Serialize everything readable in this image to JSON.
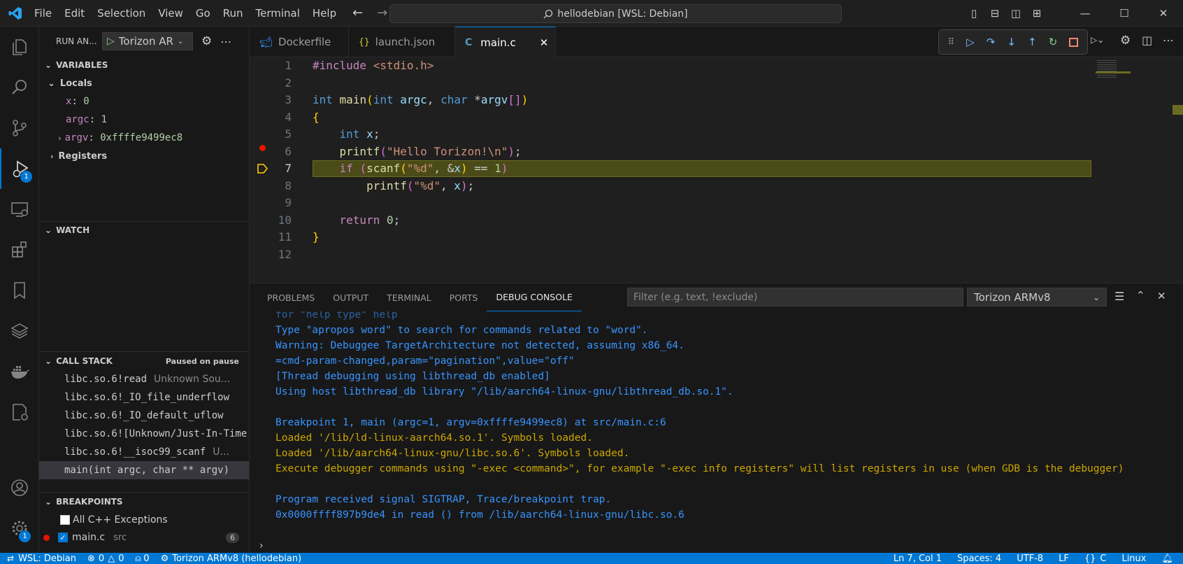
{
  "title": {
    "menus": [
      "File",
      "Edit",
      "Selection",
      "View",
      "Go",
      "Run",
      "Terminal",
      "Help"
    ],
    "command_center": "hellodebian [WSL: Debian]"
  },
  "activity": {
    "debug_badge": "1",
    "settings_badge": "1"
  },
  "sidebar": {
    "run_label": "RUN AN...",
    "config": "Torizon AR",
    "variables": {
      "header": "VARIABLES",
      "locals": "Locals",
      "items": [
        {
          "name": "x",
          "value": "0"
        },
        {
          "name": "argc",
          "value": "1"
        },
        {
          "name": "argv",
          "value": "0xffffe9499ec8"
        }
      ],
      "registers": "Registers"
    },
    "watch": {
      "header": "WATCH"
    },
    "callstack": {
      "header": "CALL STACK",
      "status": "Paused on pause",
      "frames": [
        {
          "name": "libc.so.6!read",
          "src": "Unknown Sou..."
        },
        {
          "name": "libc.so.6!_IO_file_underflow",
          "src": ""
        },
        {
          "name": "libc.so.6!_IO_default_uflow",
          "src": ""
        },
        {
          "name": "libc.so.6![Unknown/Just-In-Time",
          "src": ""
        },
        {
          "name": "libc.so.6!__isoc99_scanf",
          "src": "U..."
        },
        {
          "name": "main(int argc, char ** argv)",
          "src": ""
        }
      ]
    },
    "breakpoints": {
      "header": "BREAKPOINTS",
      "items": [
        {
          "label": "All C++ Exceptions",
          "sub": "",
          "count": ""
        },
        {
          "label": "main.c",
          "sub": "src",
          "count": "6"
        }
      ]
    }
  },
  "editor": {
    "tabs": [
      {
        "label": "Dockerfile"
      },
      {
        "label": "launch.json"
      },
      {
        "label": "main.c"
      }
    ]
  },
  "panel": {
    "tabs": [
      "PROBLEMS",
      "OUTPUT",
      "TERMINAL",
      "PORTS",
      "DEBUG CONSOLE"
    ],
    "filter_placeholder": "Filter (e.g. text, !exclude)",
    "select": "Torizon ARMv8",
    "lines": [
      {
        "t": "Type \"apropos word\" to search for commands related to \"word\".",
        "c": "blue"
      },
      {
        "t": "Warning: Debuggee TargetArchitecture not detected, assuming x86_64.",
        "c": "blue"
      },
      {
        "t": "=cmd-param-changed,param=\"pagination\",value=\"off\"",
        "c": "blue"
      },
      {
        "t": "[Thread debugging using libthread_db enabled]",
        "c": "blue"
      },
      {
        "t": "Using host libthread_db library \"/lib/aarch64-linux-gnu/libthread_db.so.1\".",
        "c": "blue"
      },
      {
        "t": "",
        "c": "blue"
      },
      {
        "t": "Breakpoint 1, main (argc=1, argv=0xffffe9499ec8) at src/main.c:6",
        "c": "blue"
      },
      {
        "t": "Loaded '/lib/ld-linux-aarch64.so.1'. Symbols loaded.",
        "c": "orange"
      },
      {
        "t": "Loaded '/lib/aarch64-linux-gnu/libc.so.6'. Symbols loaded.",
        "c": "orange"
      },
      {
        "t": "Execute debugger commands using \"-exec <command>\", for example \"-exec info registers\" will list registers in use (when GDB is the debugger)",
        "c": "orange"
      },
      {
        "t": "",
        "c": "blue"
      },
      {
        "t": "Program received signal SIGTRAP, Trace/breakpoint trap.",
        "c": "blue"
      },
      {
        "t": "0x0000ffff897b9de4 in read () from /lib/aarch64-linux-gnu/libc.so.6",
        "c": "blue"
      }
    ]
  },
  "status": {
    "remote": "WSL: Debian",
    "errors": "0",
    "warnings": "0",
    "ports": "0",
    "target": "Torizon ARMv8 (hellodebian)",
    "position": "Ln 7, Col 1",
    "spaces": "Spaces: 4",
    "encoding": "UTF-8",
    "eol": "LF",
    "lang": "C",
    "os": "Linux"
  }
}
